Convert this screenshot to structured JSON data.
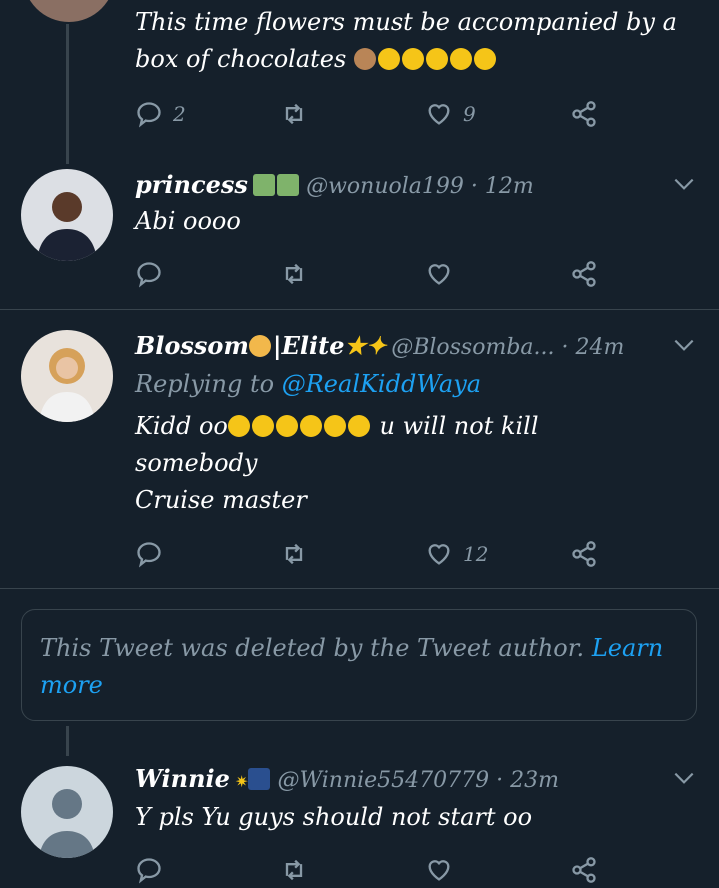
{
  "tweets": [
    {
      "text_line1": "This time flowers must be accompanied by a",
      "text_line2": "box of chocolates",
      "replies": "2",
      "likes": "9"
    },
    {
      "name": "princess",
      "handle": "@wonuola199 · 12m",
      "text": "Abi oooo",
      "replies": "",
      "likes": ""
    },
    {
      "name": "Blossom",
      "name_suffix": "|Elite",
      "handle": "@Blossomba... · 24m",
      "replying_prefix": "Replying to",
      "replying_to": "@RealKiddWaya",
      "text_line1a": "Kidd oo",
      "text_line1b": "u will not kill",
      "text_line2": "somebody",
      "text_line3": "Cruise master",
      "replies": "",
      "likes": "12"
    },
    {
      "deleted_text": "This Tweet was deleted by the Tweet author.",
      "deleted_link_a": "Learn",
      "deleted_link_b": "more"
    },
    {
      "name": "Winnie",
      "handle": "@Winnie55470779 · 23m",
      "text": "Y pls Yu guys should not start oo"
    }
  ],
  "colors": {
    "background": "#15202b",
    "muted": "#8899a6",
    "link": "#1da1f2",
    "divider": "#38444d"
  },
  "icons": [
    "reply-icon",
    "retweet-icon",
    "like-icon",
    "share-icon",
    "chevron-down-icon"
  ]
}
